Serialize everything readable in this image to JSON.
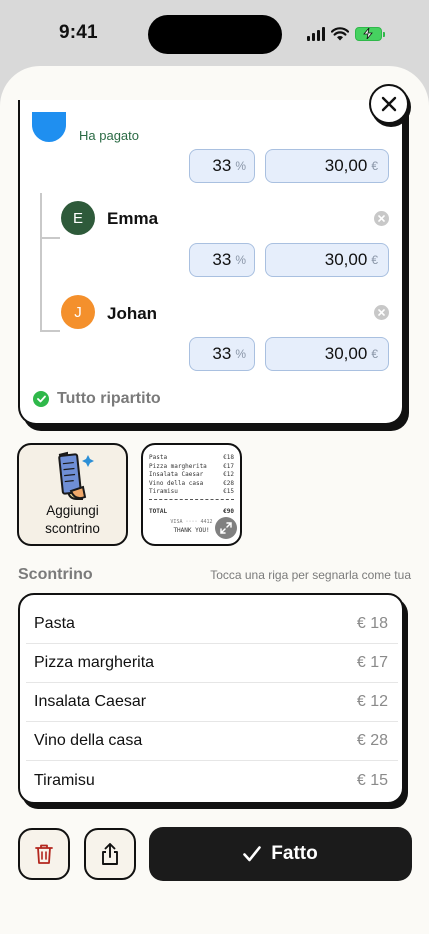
{
  "status_bar": {
    "time": "9:41"
  },
  "split": {
    "first_person_status": "Ha pagato",
    "first_row": {
      "percent": "33",
      "percent_unit": "%",
      "amount": "30,00",
      "currency": "€"
    },
    "people": [
      {
        "initial": "E",
        "name": "Emma",
        "percent": "33",
        "percent_unit": "%",
        "amount": "30,00",
        "currency": "€",
        "color": "#2e5a3a"
      },
      {
        "initial": "J",
        "name": "Johan",
        "percent": "33",
        "percent_unit": "%",
        "amount": "30,00",
        "currency": "€",
        "color": "#f4902c"
      }
    ],
    "status_label": "Tutto ripartito"
  },
  "receipt_tiles": {
    "add_line1": "Aggiungi",
    "add_line2": "scontrino",
    "thumbnail": {
      "rows": [
        {
          "name": "Pasta",
          "price": "€18"
        },
        {
          "name": "Pizza margherita",
          "price": "€17"
        },
        {
          "name": "Insalata Caesar",
          "price": "€12"
        },
        {
          "name": "Vino della casa",
          "price": "€28"
        },
        {
          "name": "Tiramisu",
          "price": "€15"
        }
      ],
      "total_label": "TOTAL",
      "total_value": "€90",
      "footer_mid": "VISA ···· 4412",
      "thanks": "THANK YOU!"
    }
  },
  "receipt_section": {
    "title": "Scontrino",
    "hint": "Tocca una riga per segnarla come tua",
    "items": [
      {
        "name": "Pasta",
        "price": "€ 18"
      },
      {
        "name": "Pizza margherita",
        "price": "€ 17"
      },
      {
        "name": "Insalata Caesar",
        "price": "€ 12"
      },
      {
        "name": "Vino della casa",
        "price": "€ 28"
      },
      {
        "name": "Tiramisu",
        "price": "€ 15"
      }
    ]
  },
  "actions": {
    "done_label": "Fatto"
  },
  "icons": {
    "close": "close-icon",
    "delete": "trash-icon",
    "share": "share-icon",
    "done": "checkmark-icon",
    "expand": "expand-icon",
    "remove": "remove-x-icon"
  },
  "colors": {
    "accent_dark": "#1b1b1b",
    "success": "#2fb84a",
    "danger": "#b3261e",
    "pill_bg": "#e6eefb"
  }
}
